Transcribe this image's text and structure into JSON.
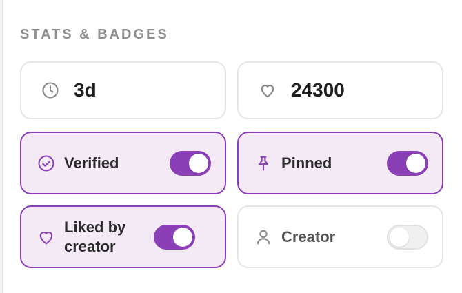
{
  "section": {
    "title": "STATS & BADGES"
  },
  "stats": [
    {
      "icon": "clock-icon",
      "value": "3d"
    },
    {
      "icon": "heart-outline-icon",
      "value": "24300"
    }
  ],
  "badges": [
    {
      "icon": "check-circle-icon",
      "label": "Verified",
      "enabled": true
    },
    {
      "icon": "pin-icon",
      "label": "Pinned",
      "enabled": true
    },
    {
      "icon": "heart-icon",
      "label": "Liked by creator",
      "enabled": true
    },
    {
      "icon": "user-icon",
      "label": "Creator",
      "enabled": false
    }
  ],
  "colors": {
    "accent": "#8a3fb7",
    "accent_bg": "#f3eaf6",
    "border": "#e6e6e6",
    "muted_text": "#8f8f8f"
  }
}
